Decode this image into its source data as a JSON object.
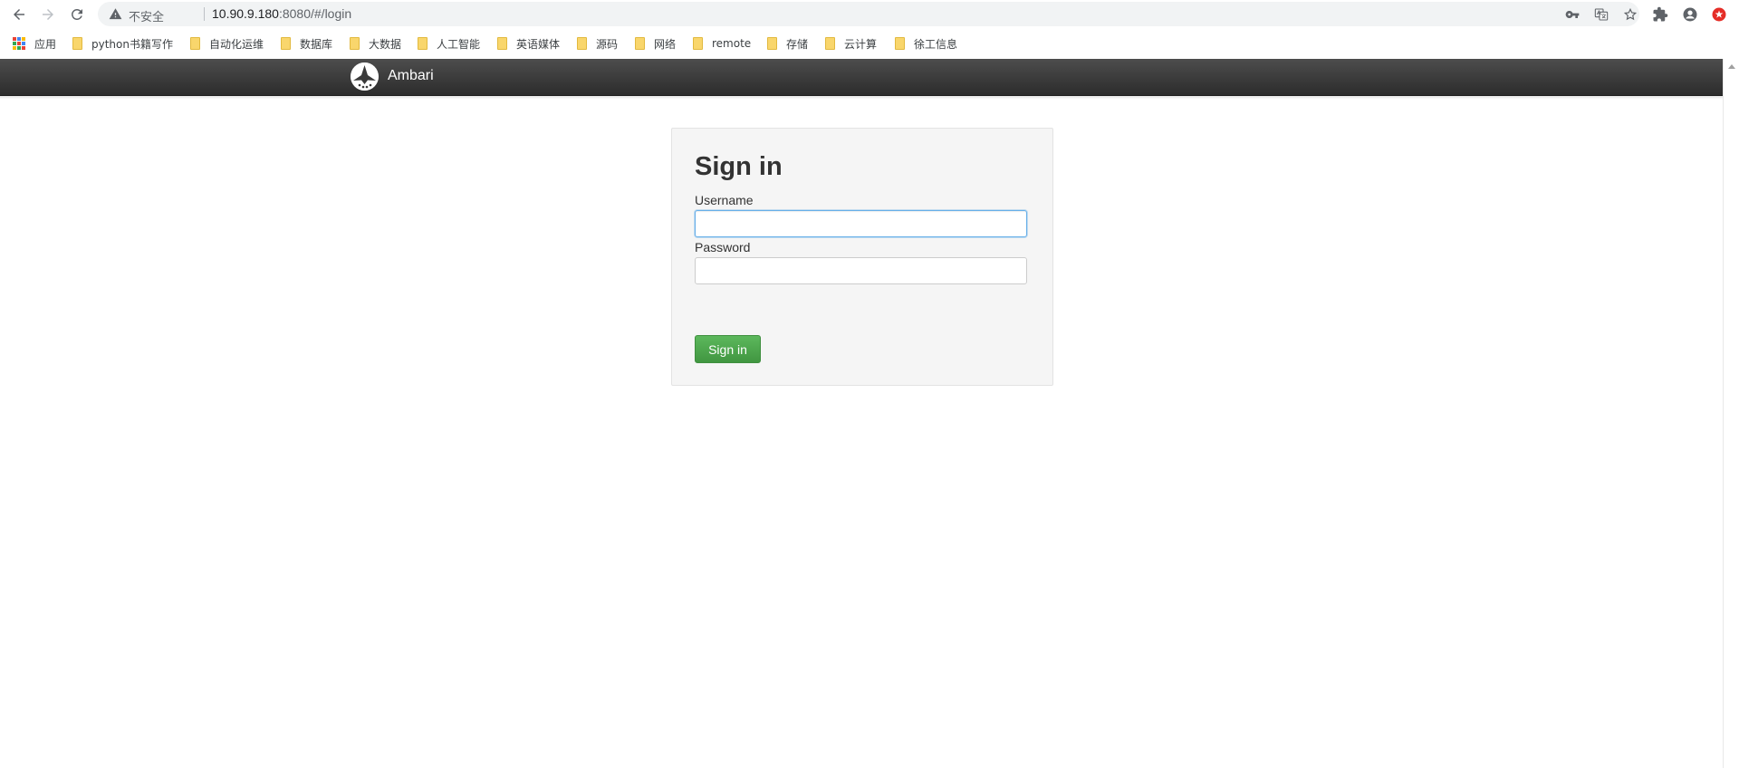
{
  "browser": {
    "security_label": "不安全",
    "url_host": "10.90.9.180",
    "url_rest": ":8080/#/login",
    "bookmarks": [
      {
        "label": "应用",
        "kind": "apps"
      },
      {
        "label": "python书籍写作",
        "kind": "folder"
      },
      {
        "label": "自动化运维",
        "kind": "folder"
      },
      {
        "label": "数据库",
        "kind": "folder"
      },
      {
        "label": "大数据",
        "kind": "folder"
      },
      {
        "label": "人工智能",
        "kind": "folder"
      },
      {
        "label": "英语媒体",
        "kind": "folder"
      },
      {
        "label": "源码",
        "kind": "folder"
      },
      {
        "label": "网络",
        "kind": "folder"
      },
      {
        "label": "remote",
        "kind": "folder"
      },
      {
        "label": "存储",
        "kind": "folder"
      },
      {
        "label": "云计算",
        "kind": "folder"
      },
      {
        "label": "徐工信息",
        "kind": "folder"
      }
    ],
    "icons": [
      "back-icon",
      "forward-icon",
      "reload-icon",
      "warning-icon",
      "key-icon",
      "translate-icon",
      "star-icon",
      "extensions-icon",
      "profile-icon",
      "extension-red-icon"
    ]
  },
  "app": {
    "brand": "Ambari",
    "navbar_color": "#333333"
  },
  "login": {
    "title": "Sign in",
    "username_label": "Username",
    "username_value": "",
    "password_label": "Password",
    "password_value": "",
    "submit_label": "Sign in",
    "submit_color": "#5cb85c"
  }
}
